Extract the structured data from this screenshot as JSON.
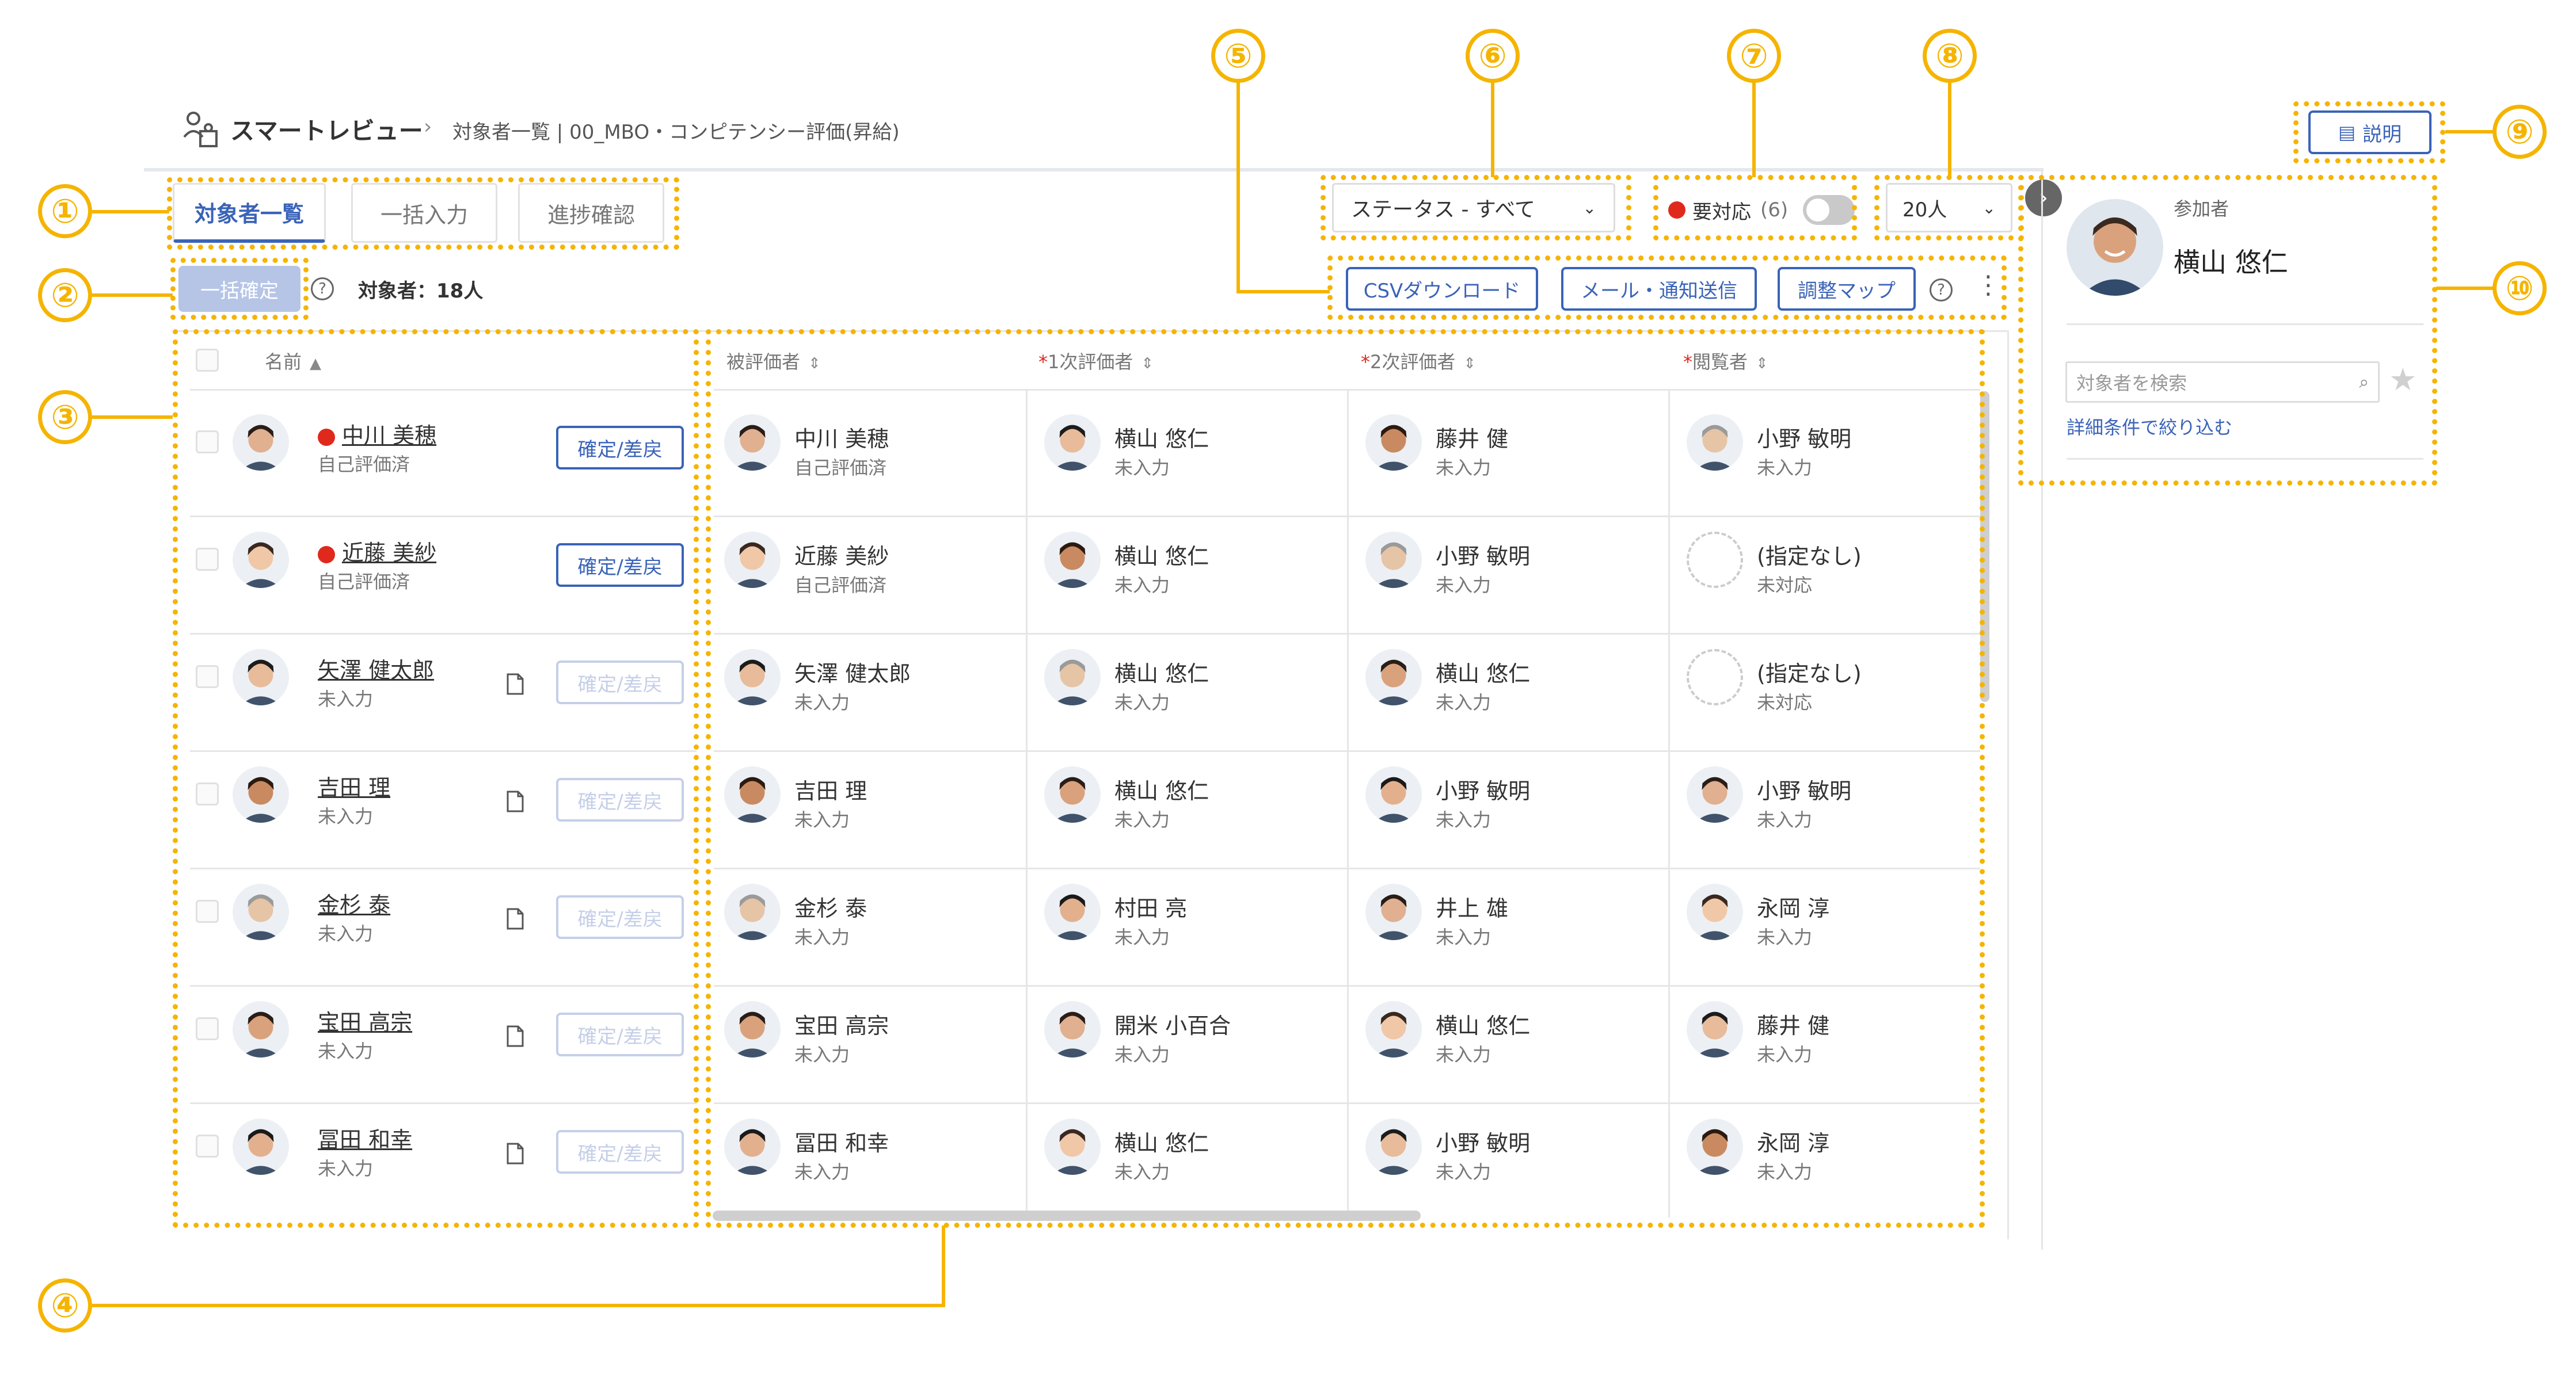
{
  "colors": {
    "accent": "#3a63b8",
    "callout": "#f5b400",
    "alert": "#e0291d"
  },
  "header": {
    "app_name": "スマートレビュー",
    "breadcrumb": "対象者一覧 | 00_MBO・コンピテンシー評価(昇給)",
    "explain_label": "説明"
  },
  "tabs": [
    {
      "label": "対象者一覧"
    },
    {
      "label": "一括入力"
    },
    {
      "label": "進捗確認"
    }
  ],
  "toolbar": {
    "status_filter": "ステータス - すべて",
    "needs_action_label": "要対応",
    "needs_action_count": "(6)",
    "page_size": "20人",
    "bulk_confirm": "一括確定",
    "target_count": "対象者：18人",
    "csv_download": "CSVダウンロード",
    "mail_send": "メール・通知送信",
    "adjust_map": "調整マップ"
  },
  "left_table": {
    "header": "名前",
    "confirm_label": "確定/差戻"
  },
  "columns": {
    "evaluatee": "被評価者",
    "first": "1次評価者",
    "second": "2次評価者",
    "viewer": "閲覧者",
    "required_mark": "*"
  },
  "rows": [
    {
      "name": "中川 美穂",
      "state": "自己評価済",
      "alert": true,
      "confirm_enabled": true,
      "first": {
        "name": "横山 悠仁",
        "state": "未入力"
      },
      "second": {
        "name": "藤井 健",
        "state": "未入力"
      },
      "viewer": {
        "name": "小野 敏明",
        "state": "未入力"
      }
    },
    {
      "name": "近藤 美紗",
      "state": "自己評価済",
      "alert": true,
      "confirm_enabled": true,
      "first": {
        "name": "横山 悠仁",
        "state": "未入力"
      },
      "second": {
        "name": "小野 敏明",
        "state": "未入力"
      },
      "viewer": {
        "name": "(指定なし)",
        "state": "未対応"
      }
    },
    {
      "name": "矢澤 健太郎",
      "state": "未入力",
      "alert": false,
      "confirm_enabled": false,
      "first": {
        "name": "横山 悠仁",
        "state": "未入力"
      },
      "second": {
        "name": "横山 悠仁",
        "state": "未入力"
      },
      "viewer": {
        "name": "(指定なし)",
        "state": "未対応"
      }
    },
    {
      "name": "吉田 理",
      "state": "未入力",
      "alert": false,
      "confirm_enabled": false,
      "first": {
        "name": "横山 悠仁",
        "state": "未入力"
      },
      "second": {
        "name": "小野 敏明",
        "state": "未入力"
      },
      "viewer": {
        "name": "小野 敏明",
        "state": "未入力"
      }
    },
    {
      "name": "金杉 泰",
      "state": "未入力",
      "alert": false,
      "confirm_enabled": false,
      "first": {
        "name": "村田 亮",
        "state": "未入力"
      },
      "second": {
        "name": "井上 雄",
        "state": "未入力"
      },
      "viewer": {
        "name": "永岡 淳",
        "state": "未入力"
      }
    },
    {
      "name": "宝田 高宗",
      "state": "未入力",
      "alert": false,
      "confirm_enabled": false,
      "first": {
        "name": "開米 小百合",
        "state": "未入力"
      },
      "second": {
        "name": "横山 悠仁",
        "state": "未入力"
      },
      "viewer": {
        "name": "藤井 健",
        "state": "未入力"
      }
    },
    {
      "name": "冨田 和幸",
      "state": "未入力",
      "alert": false,
      "confirm_enabled": false,
      "first": {
        "name": "横山 悠仁",
        "state": "未入力"
      },
      "second": {
        "name": "小野 敏明",
        "state": "未入力"
      },
      "viewer": {
        "name": "永岡 淳",
        "state": "未入力"
      }
    }
  ],
  "side_panel": {
    "section_label": "参加者",
    "participant_name": "横山 悠仁",
    "search_placeholder": "対象者を検索",
    "filter_link": "詳細条件で絞り込む"
  },
  "callouts": [
    "①",
    "②",
    "③",
    "④",
    "⑤",
    "⑥",
    "⑦",
    "⑧",
    "⑨",
    "⑩"
  ]
}
